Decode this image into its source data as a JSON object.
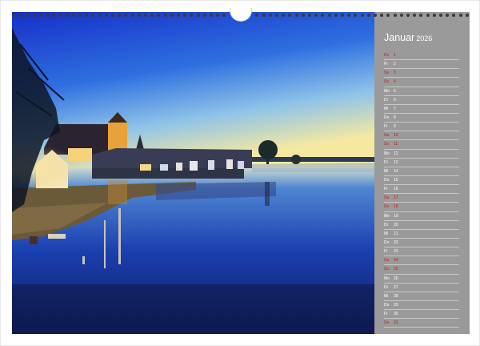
{
  "calendar": {
    "month": "Januar",
    "year": "2026",
    "days": [
      {
        "wd": "Do",
        "d": "1",
        "red": true
      },
      {
        "wd": "Fr",
        "d": "2",
        "red": false
      },
      {
        "wd": "Sa",
        "d": "3",
        "red": true
      },
      {
        "wd": "So",
        "d": "4",
        "red": true
      },
      {
        "wd": "Mo",
        "d": "5",
        "red": false
      },
      {
        "wd": "Di",
        "d": "6",
        "red": false
      },
      {
        "wd": "Mi",
        "d": "7",
        "red": false
      },
      {
        "wd": "Do",
        "d": "8",
        "red": false
      },
      {
        "wd": "Fr",
        "d": "9",
        "red": false
      },
      {
        "wd": "Sa",
        "d": "10",
        "red": true
      },
      {
        "wd": "So",
        "d": "11",
        "red": true
      },
      {
        "wd": "Mo",
        "d": "12",
        "red": false
      },
      {
        "wd": "Di",
        "d": "13",
        "red": false
      },
      {
        "wd": "Mi",
        "d": "14",
        "red": false
      },
      {
        "wd": "Do",
        "d": "15",
        "red": false
      },
      {
        "wd": "Fr",
        "d": "16",
        "red": false
      },
      {
        "wd": "Sa",
        "d": "17",
        "red": true
      },
      {
        "wd": "So",
        "d": "18",
        "red": true
      },
      {
        "wd": "Mo",
        "d": "19",
        "red": false
      },
      {
        "wd": "Di",
        "d": "20",
        "red": false
      },
      {
        "wd": "Mi",
        "d": "21",
        "red": false
      },
      {
        "wd": "Do",
        "d": "22",
        "red": false
      },
      {
        "wd": "Fr",
        "d": "23",
        "red": false
      },
      {
        "wd": "Sa",
        "d": "24",
        "red": true
      },
      {
        "wd": "So",
        "d": "25",
        "red": true
      },
      {
        "wd": "Mo",
        "d": "26",
        "red": false
      },
      {
        "wd": "Di",
        "d": "27",
        "red": false
      },
      {
        "wd": "Mi",
        "d": "28",
        "red": false
      },
      {
        "wd": "Do",
        "d": "29",
        "red": false
      },
      {
        "wd": "Fr",
        "d": "30",
        "red": false
      },
      {
        "wd": "Sa",
        "d": "31",
        "red": true
      }
    ]
  },
  "colors": {
    "panel": "#9a9a9a",
    "weekend": "#c0181f",
    "sky_top": "#1c3fd8",
    "horizon": "#f3e8a6",
    "water": "#1b2f8c"
  },
  "icons": {
    "binding": "spiral-binding",
    "hanger": "hanger-notch"
  }
}
